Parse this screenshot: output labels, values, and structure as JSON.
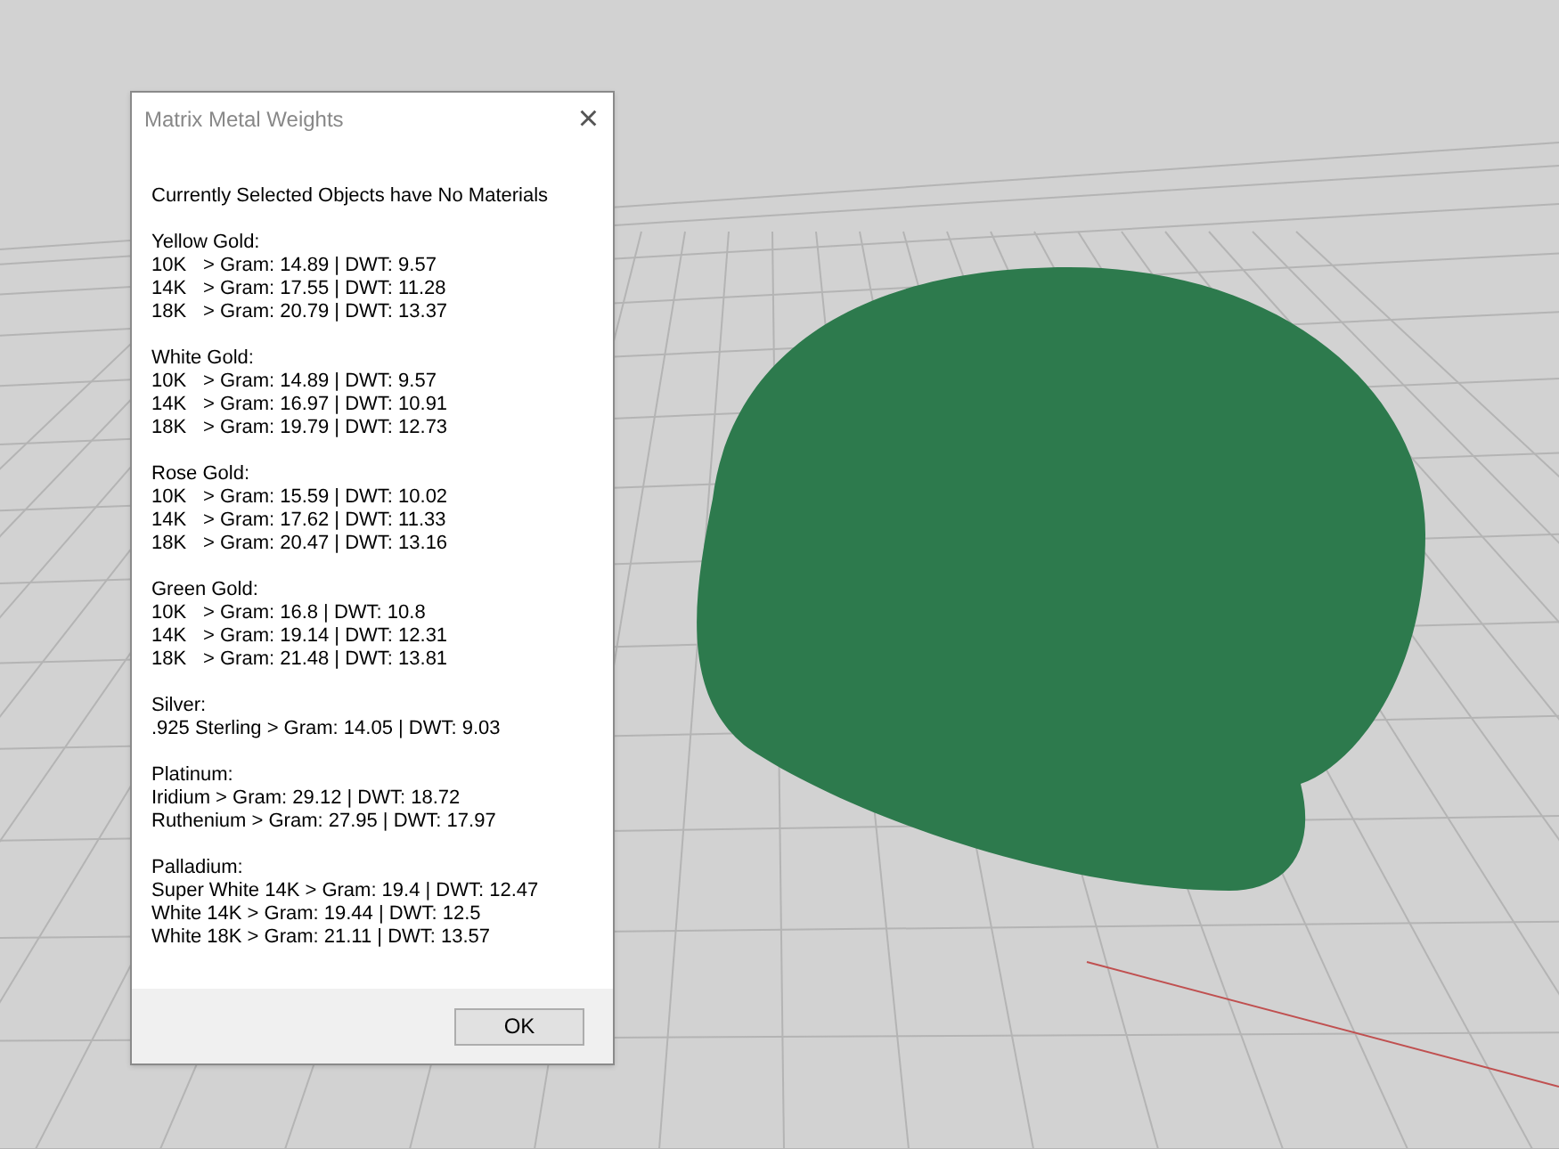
{
  "dialog": {
    "title": "Matrix Metal Weights",
    "close": "×",
    "message": "Currently Selected Objects have No Materials",
    "groups": [
      {
        "name": "Yellow Gold:",
        "kind": "karat",
        "rows": [
          {
            "label": "10K",
            "value": "> Gram: 14.89 | DWT: 9.57"
          },
          {
            "label": "14K",
            "value": "> Gram: 17.55 | DWT: 11.28"
          },
          {
            "label": "18K",
            "value": "> Gram: 20.79 | DWT: 13.37"
          }
        ]
      },
      {
        "name": "White Gold:",
        "kind": "karat",
        "rows": [
          {
            "label": "10K",
            "value": "> Gram: 14.89 | DWT: 9.57"
          },
          {
            "label": "14K",
            "value": "> Gram: 16.97 | DWT: 10.91"
          },
          {
            "label": "18K",
            "value": "> Gram: 19.79 | DWT: 12.73"
          }
        ]
      },
      {
        "name": "Rose Gold:",
        "kind": "karat",
        "rows": [
          {
            "label": "10K",
            "value": "> Gram: 15.59 | DWT: 10.02"
          },
          {
            "label": "14K",
            "value": "> Gram: 17.62 | DWT: 11.33"
          },
          {
            "label": "18K",
            "value": "> Gram: 20.47 | DWT: 13.16"
          }
        ]
      },
      {
        "name": "Green Gold:",
        "kind": "karat",
        "rows": [
          {
            "label": "10K",
            "value": "> Gram: 16.8 | DWT: 10.8"
          },
          {
            "label": "14K",
            "value": "> Gram: 19.14 | DWT: 12.31"
          },
          {
            "label": "18K",
            "value": "> Gram: 21.48 | DWT: 13.81"
          }
        ]
      },
      {
        "name": "Silver:",
        "kind": "line",
        "rows": [
          {
            "value": ".925 Sterling > Gram: 14.05 | DWT: 9.03"
          }
        ]
      },
      {
        "name": "Platinum:",
        "kind": "line",
        "rows": [
          {
            "value": "Iridium > Gram: 29.12 | DWT: 18.72"
          },
          {
            "value": "Ruthenium > Gram: 27.95 | DWT: 17.97"
          }
        ]
      },
      {
        "name": "Palladium:",
        "kind": "line",
        "rows": [
          {
            "value": "Super White 14K > Gram: 19.4 | DWT: 12.47"
          },
          {
            "value": "White 14K > Gram: 19.44 | DWT: 12.5"
          },
          {
            "value": "White 18K > Gram: 21.11 | DWT: 13.57"
          }
        ]
      }
    ],
    "button": "OK"
  }
}
